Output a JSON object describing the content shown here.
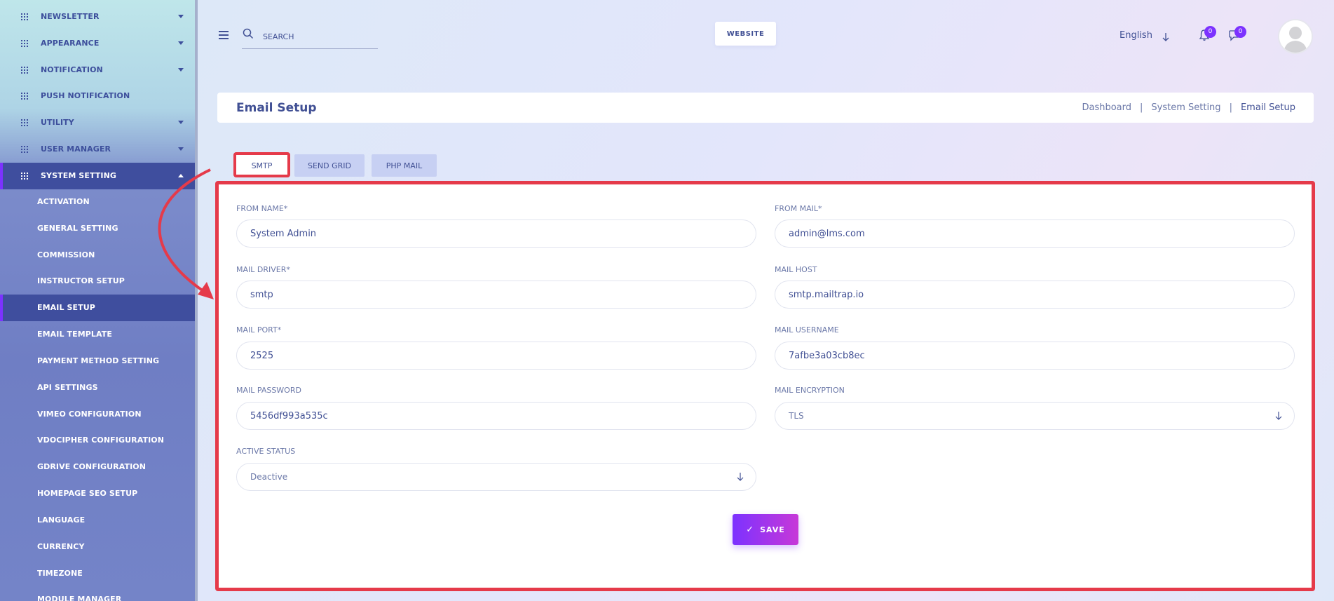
{
  "sidebar": {
    "items": [
      {
        "label": "NEWSLETTER"
      },
      {
        "label": "APPEARANCE"
      },
      {
        "label": "NOTIFICATION"
      },
      {
        "label": "PUSH NOTIFICATION"
      },
      {
        "label": "UTILITY"
      },
      {
        "label": "USER MANAGER"
      },
      {
        "label": "SYSTEM SETTING"
      }
    ],
    "sub_items": [
      {
        "label": "ACTIVATION"
      },
      {
        "label": "GENERAL SETTING"
      },
      {
        "label": "COMMISSION"
      },
      {
        "label": "INSTRUCTOR SETUP"
      },
      {
        "label": "EMAIL SETUP"
      },
      {
        "label": "EMAIL TEMPLATE"
      },
      {
        "label": "PAYMENT METHOD SETTING"
      },
      {
        "label": "API SETTINGS"
      },
      {
        "label": "VIMEO CONFIGURATION"
      },
      {
        "label": "VDOCIPHER CONFIGURATION"
      },
      {
        "label": "GDRIVE CONFIGURATION"
      },
      {
        "label": "HOMEPAGE SEO SETUP"
      },
      {
        "label": "LANGUAGE"
      },
      {
        "label": "CURRENCY"
      },
      {
        "label": "TIMEZONE"
      },
      {
        "label": "MODULE MANAGER"
      }
    ]
  },
  "header": {
    "search_placeholder": "SEARCH",
    "website_label": "WEBSITE",
    "language": "English",
    "notification_count": "0",
    "message_count": "0"
  },
  "page": {
    "title": "Email Setup",
    "breadcrumb": [
      "Dashboard",
      "System Setting",
      "Email Setup"
    ],
    "breadcrumb_sep": "|"
  },
  "tabs": [
    {
      "label": "SMTP"
    },
    {
      "label": "SEND GRID"
    },
    {
      "label": "PHP MAIL"
    }
  ],
  "form": {
    "from_name": {
      "label": "FROM NAME*",
      "value": "System Admin"
    },
    "from_mail": {
      "label": "FROM MAIL*",
      "value": "admin@lms.com"
    },
    "mail_driver": {
      "label": "MAIL DRIVER*",
      "value": "smtp"
    },
    "mail_host": {
      "label": "MAIL HOST",
      "value": "smtp.mailtrap.io"
    },
    "mail_port": {
      "label": "MAIL PORT*",
      "value": "2525"
    },
    "mail_username": {
      "label": "MAIL USERNAME",
      "value": "7afbe3a03cb8ec"
    },
    "mail_password": {
      "label": "MAIL PASSWORD",
      "value": "5456df993a535c"
    },
    "mail_encryption": {
      "label": "MAIL ENCRYPTION",
      "value": "TLS"
    },
    "active_status": {
      "label": "ACTIVE STATUS",
      "value": "Deactive"
    },
    "save_label": "SAVE"
  },
  "colors": {
    "accent": "#7c32ff",
    "highlight": "#e53a4a",
    "text": "#415094"
  }
}
